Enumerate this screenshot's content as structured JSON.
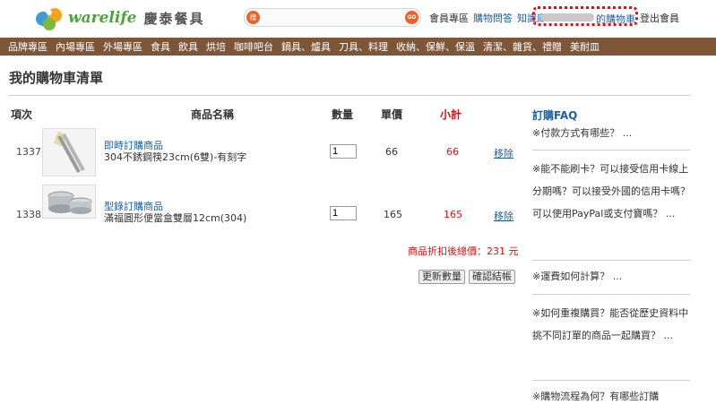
{
  "header": {
    "logo_text": "warelife",
    "logo_cn": "慶泰餐具",
    "search_icon_text": "搜",
    "search_placeholder": "",
    "go_label": "GO",
    "links": [
      {
        "label": "會員專區",
        "style": "plain"
      },
      {
        "label": "購物問答",
        "style": "blue"
      },
      {
        "label": "知識庫",
        "style": "blue"
      }
    ],
    "cart_link": "的購物車",
    "logout": "登出會員"
  },
  "nav": [
    "品牌專區",
    "內場專區",
    "外場專區",
    "食具",
    "飲具",
    "烘培",
    "咖啡吧台",
    "鍋具、爐具",
    "刀具、料理",
    "收納、保鮮、保溫",
    "清潔、雜貨、禮贈",
    "美耐皿"
  ],
  "page_title": "我的購物車清單",
  "table": {
    "headers": {
      "id": "項次",
      "name": "商品名稱",
      "qty": "數量",
      "price": "單價",
      "subtotal": "小計"
    },
    "rows": [
      {
        "id": "1337",
        "type_link": "即時訂購商品",
        "desc": "304不銹鋼筷23cm(6雙)-有刻字",
        "qty": "1",
        "price": "66",
        "subtotal": "66",
        "remove": "移除"
      },
      {
        "id": "1338",
        "type_link": "型錄訂購商品",
        "desc": "滿福圓形便當盒雙層12cm(304)",
        "qty": "1",
        "price": "165",
        "subtotal": "165",
        "remove": "移除"
      }
    ],
    "total": "商品折扣後總價：231 元",
    "update_button": "更新數量",
    "checkout_button": "確認結帳"
  },
  "faq": {
    "title": "訂購FAQ",
    "items": [
      "※付款方式有哪些？ ...",
      "※能不能刷卡？可以接受信用卡線上分期嗎？可以接受外國的信用卡嗎？可以使用PayPal或支付寶嗎？ ...",
      "※運費如何計算？ ...",
      "※如何重複購買？能否從歷史資料中挑不同訂單的商品一起購買？ ...",
      "※購物流程為何？有哪些訂購"
    ]
  },
  "colors": {
    "brown_nav": "#7d5638",
    "link_blue": "#1a5fa8",
    "red": "#e01010",
    "logo_green": "#4fa23d"
  }
}
